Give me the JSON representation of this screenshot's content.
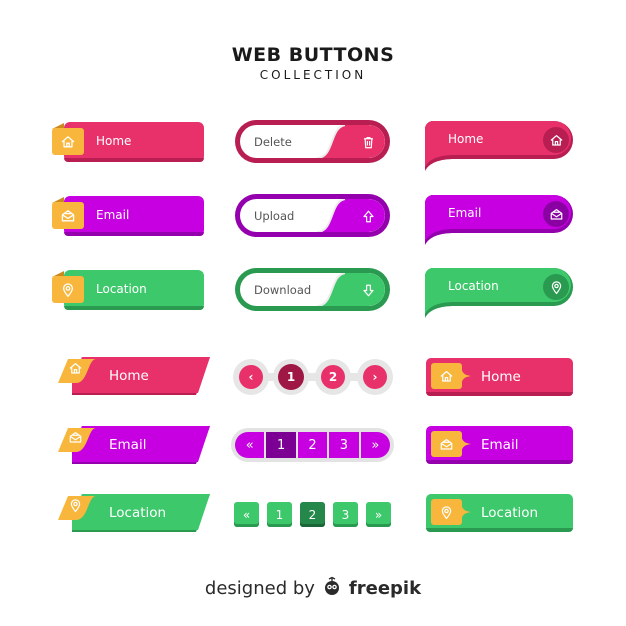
{
  "header": {
    "title": "WEB BUTTONS",
    "subtitle": "COLLECTION"
  },
  "colors": {
    "pink": "#e8306a",
    "pink_dark": "#b81e52",
    "pink_deep": "#9e1745",
    "purple": "#c600e0",
    "purple_dark": "#9400ad",
    "purple_deep": "#7b0093",
    "green": "#3dc86b",
    "green_dark": "#2a9a50",
    "green_deep": "#25884a",
    "orange": "#f8b73c"
  },
  "tab_buttons": [
    {
      "label": "Home",
      "icon": "home-icon"
    },
    {
      "label": "Email",
      "icon": "email-icon"
    },
    {
      "label": "Location",
      "icon": "location-icon"
    }
  ],
  "pill_buttons": [
    {
      "label": "Delete",
      "icon": "trash-icon"
    },
    {
      "label": "Upload",
      "icon": "upload-arrow-icon"
    },
    {
      "label": "Download",
      "icon": "download-arrow-icon"
    }
  ],
  "bubble_buttons": [
    {
      "label": "Home",
      "icon": "home-icon"
    },
    {
      "label": "Email",
      "icon": "email-icon"
    },
    {
      "label": "Location",
      "icon": "location-icon"
    }
  ],
  "slant_buttons": [
    {
      "label": "Home",
      "icon": "home-icon"
    },
    {
      "label": "Email",
      "icon": "email-icon"
    },
    {
      "label": "Location",
      "icon": "location-icon"
    }
  ],
  "callout_buttons": [
    {
      "label": "Home",
      "icon": "home-icon"
    },
    {
      "label": "Email",
      "icon": "email-icon"
    },
    {
      "label": "Location",
      "icon": "location-icon"
    }
  ],
  "pagination_round": {
    "prev": "‹",
    "pages": [
      "1",
      "2"
    ],
    "next": "›",
    "active": "1"
  },
  "pagination_bar": {
    "first": "«",
    "pages": [
      "1",
      "2",
      "3"
    ],
    "last": "»",
    "active": "1"
  },
  "pagination_square": {
    "first": "«",
    "pages": [
      "1",
      "2",
      "3"
    ],
    "last": "»",
    "active": "2"
  },
  "footer": {
    "text": "designed by",
    "brand": "freepik"
  }
}
